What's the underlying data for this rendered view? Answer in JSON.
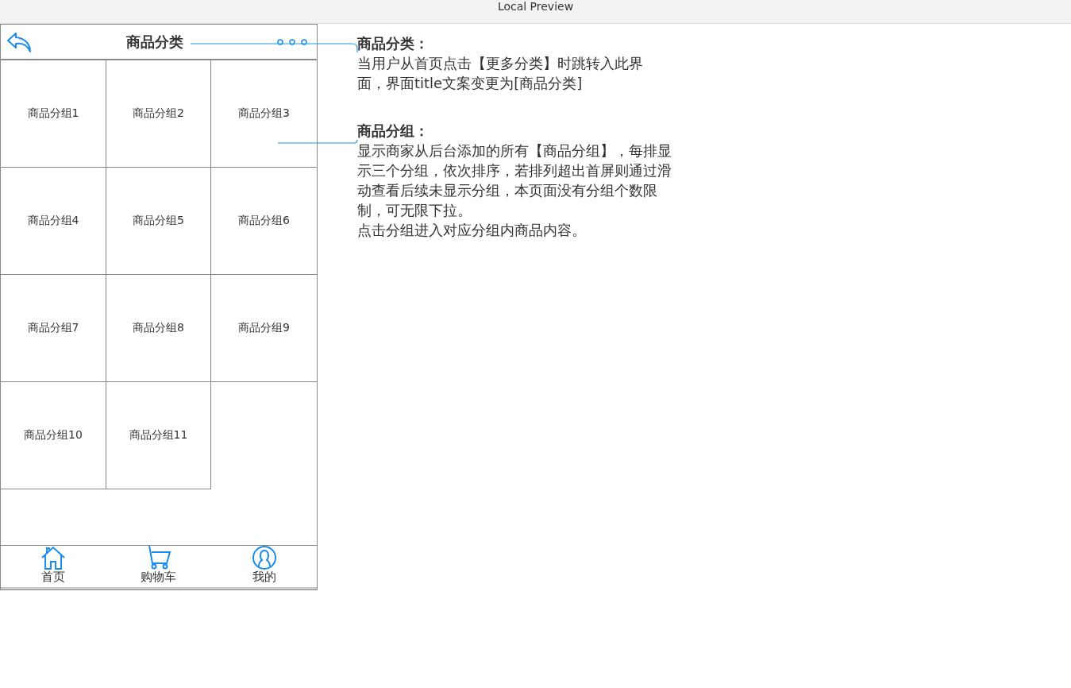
{
  "window": {
    "title": "Local Preview"
  },
  "header": {
    "title": "商品分类"
  },
  "groups": [
    "商品分组1",
    "商品分组2",
    "商品分组3",
    "商品分组4",
    "商品分组5",
    "商品分组6",
    "商品分组7",
    "商品分组8",
    "商品分组9",
    "商品分组10",
    "商品分组11"
  ],
  "tab_bar": [
    {
      "label": "首页",
      "kind": "home"
    },
    {
      "label": "购物车",
      "kind": "cart"
    },
    {
      "label": "我的",
      "kind": "user"
    }
  ],
  "notes": [
    {
      "title": "商品分类：",
      "paragraphs": [
        "当用户从首页点击【更多分类】时跳转入此界面，界面title文案变更为[商品分类]"
      ]
    },
    {
      "title": "商品分组：",
      "paragraphs": [
        "显示商家从后台添加的所有【商品分组】，每排显示三个分组，依次排序，若排列超出首屏则通过滑动查看后续未显示分组，本页面没有分组个数限制，可无限下拉。",
        "点击分组进入对应分组内商品内容。"
      ]
    }
  ]
}
